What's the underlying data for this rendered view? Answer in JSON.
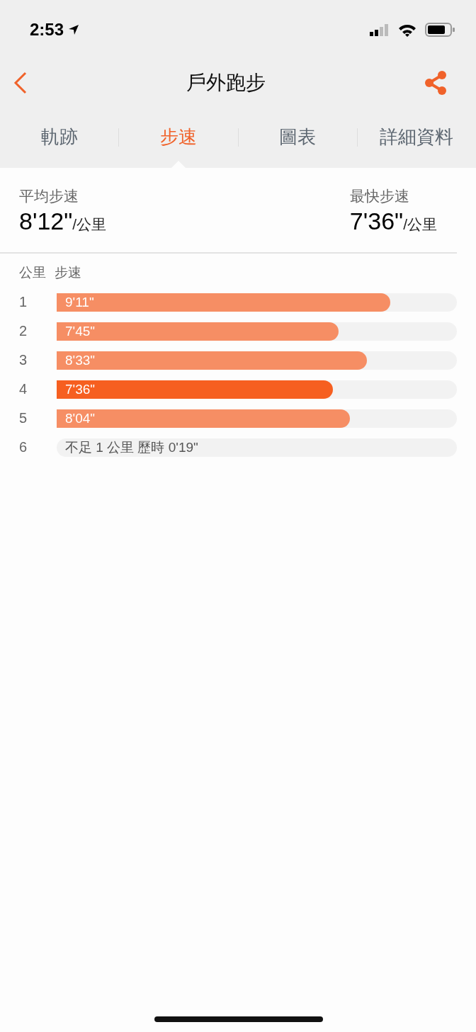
{
  "status_bar": {
    "time": "2:53"
  },
  "nav": {
    "title": "戶外跑步"
  },
  "tabs": [
    {
      "label": "軌跡",
      "selected": false
    },
    {
      "label": "步速",
      "selected": true
    },
    {
      "label": "圖表",
      "selected": false
    },
    {
      "label": "詳細資料",
      "selected": false
    }
  ],
  "summary": [
    {
      "label": "平均步速",
      "value": "8'12\"",
      "unit": "/公里"
    },
    {
      "label": "最快步速",
      "value": "7'36\"",
      "unit": "/公里"
    }
  ],
  "splits": {
    "columns": [
      "公里",
      "步速"
    ],
    "rows": [
      {
        "kind": "bar",
        "km": "1",
        "pace": "9'11\"",
        "level": 0.834,
        "fastest": false
      },
      {
        "kind": "bar",
        "km": "2",
        "pace": "7'45\"",
        "level": 0.704,
        "fastest": false
      },
      {
        "kind": "bar",
        "km": "3",
        "pace": "8'33\"",
        "level": 0.775,
        "fastest": false
      },
      {
        "kind": "bar",
        "km": "4",
        "pace": "7'36\"",
        "level": 0.69,
        "fastest": true
      },
      {
        "kind": "bar",
        "km": "5",
        "pace": "8'04\"",
        "level": 0.733,
        "fastest": false
      },
      {
        "kind": "partial",
        "km": "6",
        "pace": "不足 1 公里 歷時 0'19\""
      }
    ]
  }
}
